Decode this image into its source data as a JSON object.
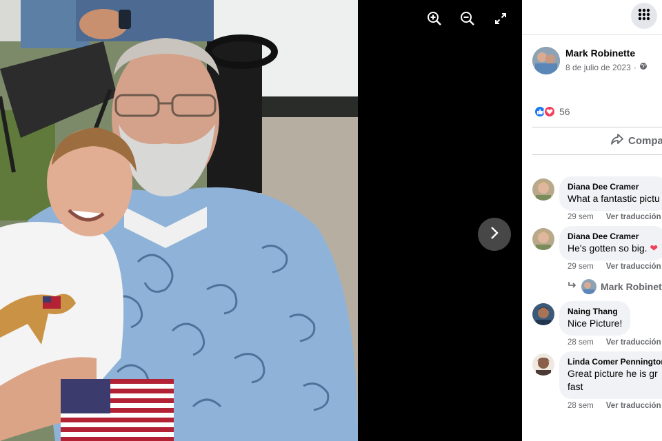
{
  "viewer": {
    "tools": [
      {
        "icon": "zoom-in-icon",
        "label": "Acercar"
      },
      {
        "icon": "zoom-out-icon",
        "label": "Alejar"
      },
      {
        "icon": "fullscreen-icon",
        "label": "Pantalla completa"
      }
    ],
    "next_icon": "chevron-right-icon"
  },
  "panel": {
    "menu_icon": "grid-menu-icon",
    "post": {
      "author": "Mark Robinette",
      "date": "8 de julio de 2023",
      "dot": "·",
      "privacy_icon": "globe-icon"
    },
    "reactions": {
      "like_icon": "like-icon",
      "love_icon": "love-icon",
      "count": "56"
    },
    "share_label": "Compa",
    "comments": [
      {
        "name": "Diana Dee Cramer",
        "text": "What a fantastic pictu",
        "time": "29 sem",
        "translate": "Ver traducción"
      },
      {
        "name": "Diana Dee Cramer",
        "text": "He's gotten so big. ",
        "emoji": "❤",
        "time": "29 sem",
        "translate": "Ver traducción"
      },
      {
        "name": "Naing Thang",
        "text": "Nice Picture!",
        "time": "28 sem",
        "translate": "Ver traducción"
      },
      {
        "name": "Linda Comer Pennington",
        "text": "Great picture he is gr",
        "text2": "fast",
        "time": "28 sem",
        "translate": "Ver traducción"
      }
    ],
    "reply": {
      "name": "Mark Robinet"
    }
  },
  "colors": {
    "facebook_blue": "#1877f2",
    "love_red": "#f33e58",
    "secondary_text": "#65676b",
    "bubble_bg": "#f0f2f5"
  }
}
